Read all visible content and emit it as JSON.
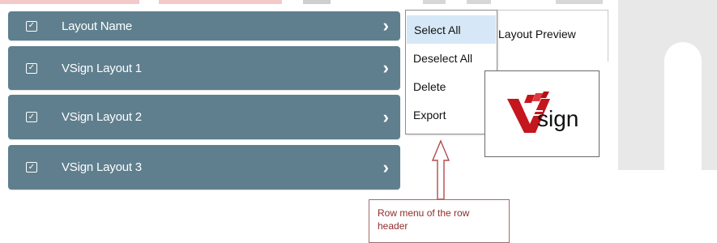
{
  "rows": [
    {
      "checked": true,
      "label": "Layout Name",
      "chevron": "›"
    },
    {
      "checked": true,
      "label": "VSign Layout 1",
      "chevron": "›"
    },
    {
      "checked": true,
      "label": "VSign Layout 2",
      "chevron": "›"
    },
    {
      "checked": true,
      "label": "VSign Layout 3",
      "chevron": "›"
    }
  ],
  "menu": {
    "items": [
      "Select All",
      "Deselect All",
      "Delete",
      "Export"
    ]
  },
  "preview": {
    "title": "Layout Preview",
    "logo_text": "sign"
  },
  "callout": {
    "text": "Row menu of the row header"
  },
  "colors": {
    "row_bg": "#5f7f8e",
    "menu_highlight": "#d6e8f7",
    "callout_text": "#8f2c2c",
    "logo_red": "#c4161c"
  },
  "icons": {
    "checkbox": "checkbox-icon",
    "chevron": "chevron-right-icon",
    "arrow": "up-arrow-icon",
    "logo": "vsign-logo-icon"
  }
}
